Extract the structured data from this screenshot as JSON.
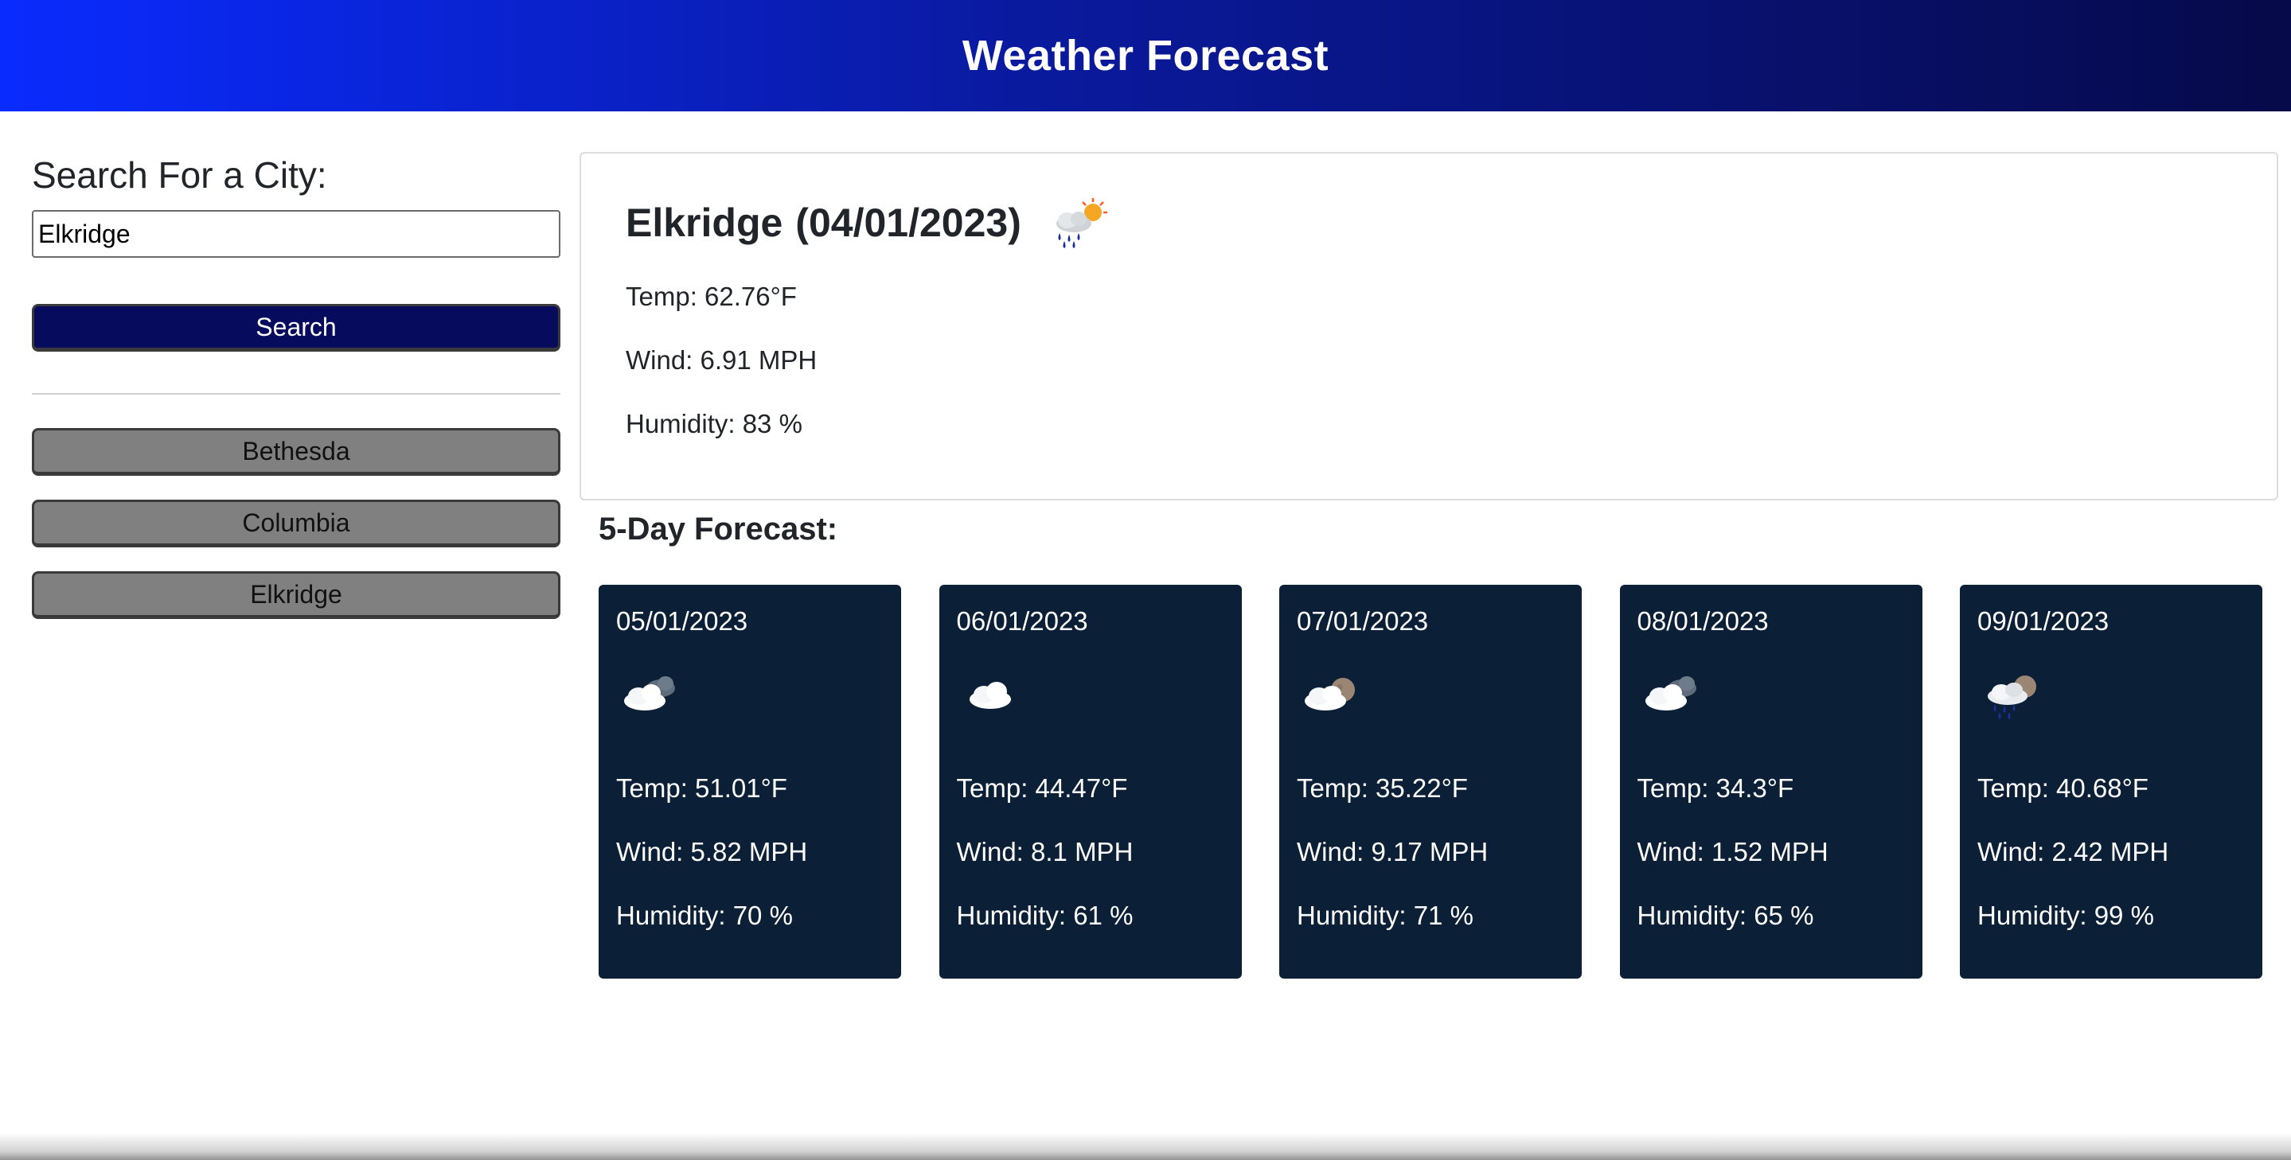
{
  "header": {
    "title": "Weather Forecast"
  },
  "sidebar": {
    "heading": "Search For a City:",
    "search_value": "Elkridge",
    "search_button": "Search",
    "history": [
      "Bethesda",
      "Columbia",
      "Elkridge"
    ]
  },
  "current": {
    "city": "Elkridge",
    "date": "(04/01/2023)",
    "icon": "rain-sun-icon",
    "temp": "Temp: 62.76°F",
    "wind": "Wind: 6.91 MPH",
    "humidity": "Humidity: 83 %"
  },
  "forecast": {
    "heading": "5-Day Forecast:",
    "days": [
      {
        "date": "05/01/2023",
        "icon": "cloud-dark-cloud-icon",
        "temp": "Temp: 51.01°F",
        "wind": "Wind: 5.82 MPH",
        "humidity": "Humidity: 70 %"
      },
      {
        "date": "06/01/2023",
        "icon": "cloud-icon",
        "temp": "Temp: 44.47°F",
        "wind": "Wind: 8.1 MPH",
        "humidity": "Humidity: 61 %"
      },
      {
        "date": "07/01/2023",
        "icon": "cloud-moon-icon",
        "temp": "Temp: 35.22°F",
        "wind": "Wind: 9.17 MPH",
        "humidity": "Humidity: 71 %"
      },
      {
        "date": "08/01/2023",
        "icon": "cloud-dark-cloud-icon",
        "temp": "Temp: 34.3°F",
        "wind": "Wind: 1.52 MPH",
        "humidity": "Humidity: 65 %"
      },
      {
        "date": "09/01/2023",
        "icon": "rain-moon-icon",
        "temp": "Temp: 40.68°F",
        "wind": "Wind: 2.42 MPH",
        "humidity": "Humidity: 99 %"
      }
    ]
  },
  "colors": {
    "header_start": "#0a2bff",
    "header_end": "#060a4a",
    "search_button": "#060b5e",
    "history_button": "#808080",
    "forecast_card": "#0b2037"
  }
}
